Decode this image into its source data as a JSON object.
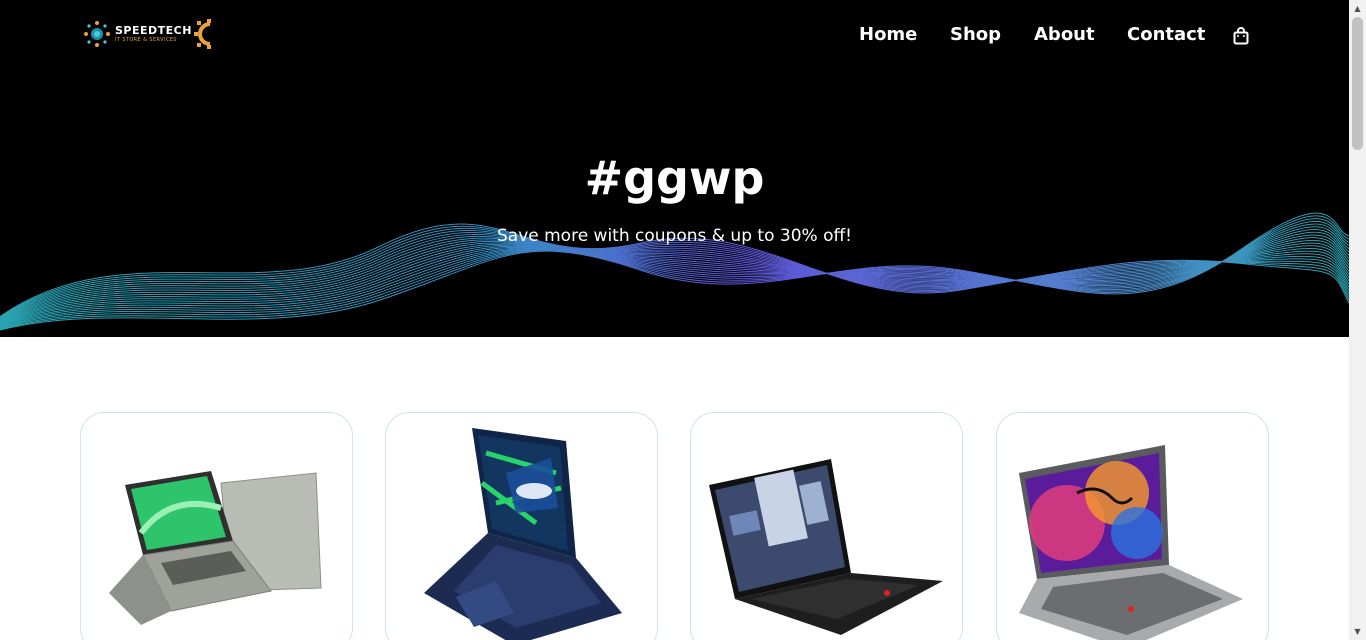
{
  "brand": {
    "name": "SPEEDTECH",
    "tagline": "IT STORE & SERVICES",
    "accent": "#e8a33a"
  },
  "nav": {
    "links": [
      {
        "label": "Home"
      },
      {
        "label": "Shop"
      },
      {
        "label": "About"
      },
      {
        "label": "Contact"
      }
    ],
    "cart_icon": "shopping-bag-icon"
  },
  "hero": {
    "title": "#ggwp",
    "subtitle": "Save more with coupons & up to 30% off!"
  },
  "products": [
    {
      "image": "laptop-green-open-icon"
    },
    {
      "image": "laptop-gaming-rog-icon"
    },
    {
      "image": "laptop-black-thinkpad-icon"
    },
    {
      "image": "laptop-silver-colorful-screen-icon"
    }
  ],
  "colors": {
    "hero_bg": "#000000",
    "card_border": "#cde6e1",
    "wave_teal": "#2fb7c6",
    "wave_purple": "#6a5ff0"
  }
}
